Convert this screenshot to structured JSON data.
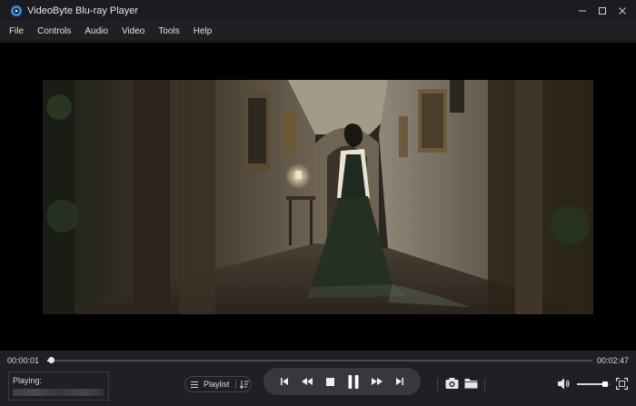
{
  "window": {
    "title": "VideoByte Blu-ray Player",
    "controls": [
      "minimize-icon",
      "maximize-icon",
      "close-icon"
    ]
  },
  "menu": {
    "items": [
      "File",
      "Controls",
      "Audio",
      "Video",
      "Tools",
      "Help"
    ]
  },
  "player": {
    "current_time": "00:00:01",
    "total_time": "00:02:47",
    "progress_fraction": 0.006,
    "volume_fraction": 0.85
  },
  "now_playing": {
    "label": "Playing:"
  },
  "playlist": {
    "label": "Playlist"
  },
  "transport": {
    "buttons": [
      "previous-icon",
      "rewind-icon",
      "stop-icon",
      "pause-icon",
      "fast-forward-icon",
      "next-icon"
    ]
  },
  "colors": {
    "background": "#1f2023",
    "video_bg": "#000000",
    "transport_pill": "#37383c",
    "accent_text": "#d8d8d8",
    "logo_blue": "#2f8fe6"
  }
}
